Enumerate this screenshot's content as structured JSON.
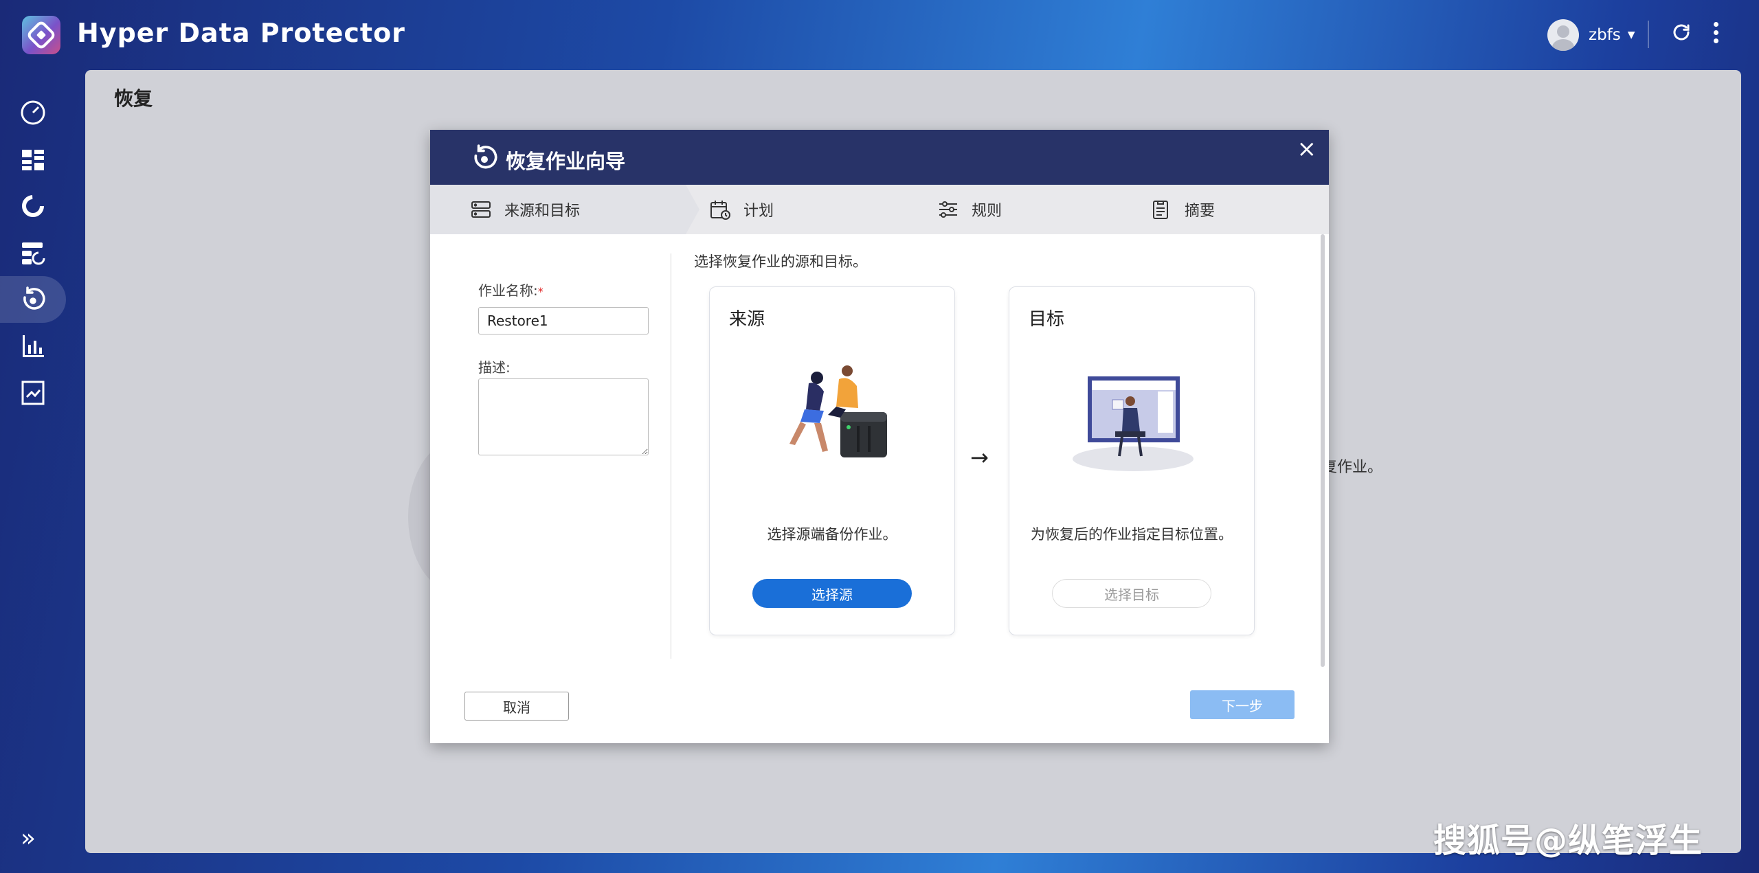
{
  "app": {
    "title": "Hyper Data Protector"
  },
  "user": {
    "name": "zbfs"
  },
  "page": {
    "title": "恢复",
    "background_hint": "复作业。"
  },
  "sidebar": {
    "items": [
      {
        "name": "dashboard-icon"
      },
      {
        "name": "overview-icon"
      },
      {
        "name": "backup-icon"
      },
      {
        "name": "storage-icon"
      },
      {
        "name": "restore-icon",
        "active": true
      },
      {
        "name": "report-icon"
      },
      {
        "name": "log-icon"
      }
    ]
  },
  "dialog": {
    "title": "恢复作业向导",
    "steps": [
      "来源和目标",
      "计划",
      "规则",
      "摘要"
    ],
    "job_name_label": "作业名称:",
    "job_name_required": "*",
    "job_name_value": "Restore1",
    "description_label": "描述:",
    "instruction": "选择恢复作业的源和目标。",
    "source_card": {
      "title": "来源",
      "description": "选择源端备份作业。",
      "button": "选择源"
    },
    "target_card": {
      "title": "目标",
      "description": "为恢复后的作业指定目标位置。",
      "button": "选择目标"
    },
    "flow_arrow": "→",
    "cancel_button": "取消",
    "next_button": "下一步"
  },
  "watermark": "搜狐号@纵笔浮生",
  "colors": {
    "dialog_header": "#283368",
    "primary_button": "#1a6fd8",
    "disabled_button": "#8bbcf3",
    "required": "#e02424"
  }
}
